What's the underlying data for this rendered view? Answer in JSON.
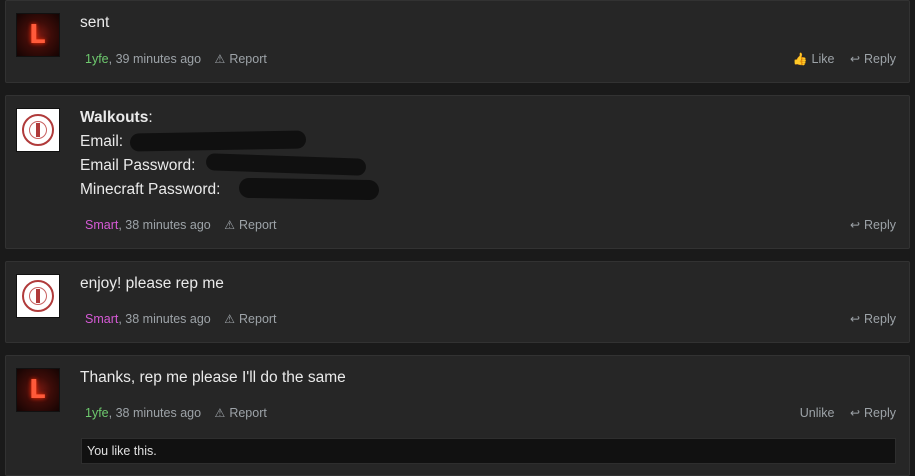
{
  "posts": [
    {
      "message": "sent",
      "author": "1yfe",
      "time": ", 39 minutes ago",
      "report": "Report",
      "like": "Like",
      "reply": "Reply"
    },
    {
      "label_title": "Walkouts",
      "label_title_colon": ":",
      "line1": "Email:",
      "line2": "Email Password:",
      "line3": "Minecraft Password:",
      "author": "Smart",
      "time": ", 38 minutes ago",
      "report": "Report",
      "reply": "Reply"
    },
    {
      "message": "enjoy! please rep me",
      "author": "Smart",
      "time": ", 38 minutes ago",
      "report": "Report",
      "reply": "Reply"
    },
    {
      "message": "Thanks, rep me please I'll do the same",
      "author": "1yfe",
      "time": ", 38 minutes ago",
      "report": "Report",
      "unlike": "Unlike",
      "reply": "Reply",
      "likes_text": "You like this."
    }
  ],
  "icons": {
    "report": "warning-triangle-icon",
    "like": "thumbs-up-icon",
    "reply": "reply-arrow-icon"
  },
  "colors": {
    "user_1yfe": "#6ec96e",
    "user_smart": "#d65ad6"
  }
}
